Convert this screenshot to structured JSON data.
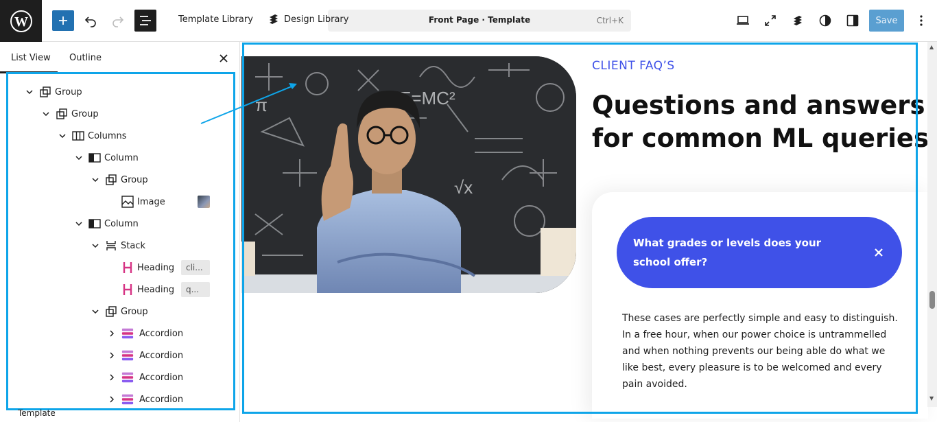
{
  "topbar": {
    "logo_icon": "wordpress-logo-icon",
    "add_icon": "plus-icon",
    "undo_icon": "undo-icon",
    "redo_icon": "redo-icon",
    "list_view_icon": "list-view-icon",
    "template_library_label": "Template Library",
    "design_library_label": "Design Library",
    "command_title": "Front Page · Template",
    "command_shortcut": "Ctrl+K",
    "save_label": "Save",
    "accent_color": "#2271b1"
  },
  "sidebar": {
    "tabs": [
      "List View",
      "Outline"
    ],
    "active_tab": "List View",
    "tree": [
      {
        "label": "Group",
        "icon": "group-icon",
        "expanded": true,
        "level": 0
      },
      {
        "label": "Group",
        "icon": "group-icon",
        "expanded": true,
        "level": 1
      },
      {
        "label": "Columns",
        "icon": "columns-icon",
        "expanded": true,
        "level": 2
      },
      {
        "label": "Column",
        "icon": "column-icon",
        "expanded": true,
        "level": 3
      },
      {
        "label": "Group",
        "icon": "group-icon",
        "expanded": true,
        "level": 4
      },
      {
        "label": "Image",
        "icon": "image-icon",
        "level": 5
      },
      {
        "label": "Column",
        "icon": "column-icon",
        "expanded": true,
        "level": 3
      },
      {
        "label": "Stack",
        "icon": "stack-icon",
        "expanded": true,
        "level": 4
      },
      {
        "label": "Heading",
        "icon": "heading-icon",
        "chip": "cli...",
        "level": 5
      },
      {
        "label": "Heading",
        "icon": "heading-icon",
        "chip": "q...",
        "level": 5
      },
      {
        "label": "Group",
        "icon": "group-icon",
        "expanded": true,
        "level": 4
      },
      {
        "label": "Accordion",
        "icon": "accordion-icon",
        "expanded": false,
        "level": 5
      },
      {
        "label": "Accordion",
        "icon": "accordion-icon",
        "expanded": false,
        "level": 5
      },
      {
        "label": "Accordion",
        "icon": "accordion-icon",
        "expanded": false,
        "level": 5
      },
      {
        "label": "Accordion",
        "icon": "accordion-icon",
        "expanded": false,
        "level": 5
      }
    ],
    "footer_label": "Template"
  },
  "canvas": {
    "eyebrow": "CLIENT FAQ’S",
    "heading": "Questions and answers for common ML queries",
    "faq_question": "What grades or levels does your school offer?",
    "faq_answer": "These cases are perfectly simple and easy to distinguish. In a free hour, when our power choice is untrammelled and when nothing prevents our being able do what we like best, every pleasure is to be welcomed and every pain avoided.",
    "brand_color": "#3f51e8",
    "image_icon": "person-thinking-image"
  }
}
